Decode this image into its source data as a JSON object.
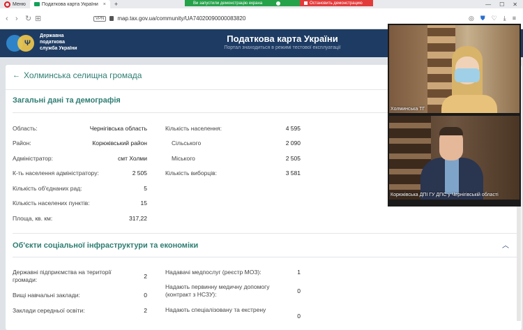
{
  "browser": {
    "menu_label": "Меню",
    "tab_title": "Податкова карта України",
    "tab_close": "×",
    "tab_add": "+",
    "demo_banner": "Ви запустили демонстрацію екрана",
    "demo_stop": "Остановить демонстрацию",
    "win_ctrls": [
      "—",
      "☐",
      "✕"
    ],
    "vpn_label": "VPN",
    "url": "map.tax.gov.ua/community/UA74020090000083820"
  },
  "header": {
    "org_line1": "Державна",
    "org_line2": "податкова",
    "org_line3": "служба України",
    "title": "Податкова карта України",
    "subtitle": "Портал знаходиться в режимі тестової експлуатації"
  },
  "page": {
    "title": "Холминська селищна громада"
  },
  "section1": {
    "title": "Загальні дані та демографія",
    "left": [
      {
        "label": "Область:",
        "value": "Чернігівська область"
      },
      {
        "label": "Район:",
        "value": "Корюківський район"
      },
      {
        "label": "Адміністратор:",
        "value": "смт Холми"
      },
      {
        "label": "К-ть населення адміністратору:",
        "value": "2 505"
      },
      {
        "label": "Кількість об'єднаних рад:",
        "value": "5"
      },
      {
        "label": "Кількість населених пунктів:",
        "value": "15"
      },
      {
        "label": "Площа, кв. км:",
        "value": "317,22"
      }
    ],
    "right": [
      {
        "label": "Кількість населення:",
        "value": "4 595"
      },
      {
        "label": "Сільського",
        "value": "2 090"
      },
      {
        "label": "Міського",
        "value": "2 505"
      },
      {
        "label": "Кількість виборців:",
        "value": "3 581"
      }
    ]
  },
  "section2": {
    "title": "Об'єкти соціальної інфраструктури та економіки",
    "left": [
      {
        "label": "Державні підприємства на території",
        "label2": "громади:",
        "value": "2"
      },
      {
        "label": "Вищі навчальні заклади:",
        "value": "0"
      },
      {
        "label": "Заклади середньої освіти:",
        "value": "2"
      }
    ],
    "right": [
      {
        "label": "Надавачі медпослуг (реєстр МОЗ):",
        "value": "1"
      },
      {
        "label": "Надають первинну медичну допомогу",
        "label2": "(контракт з НСЗУ):",
        "value": "0"
      },
      {
        "label": "Надають спеціалізовану та екстрену",
        "value": "0"
      }
    ]
  },
  "video": {
    "participant1": "Холминська ТГ",
    "participant2": "Корюківська ДПІ ГУ ДПС у Чернігівській області"
  }
}
